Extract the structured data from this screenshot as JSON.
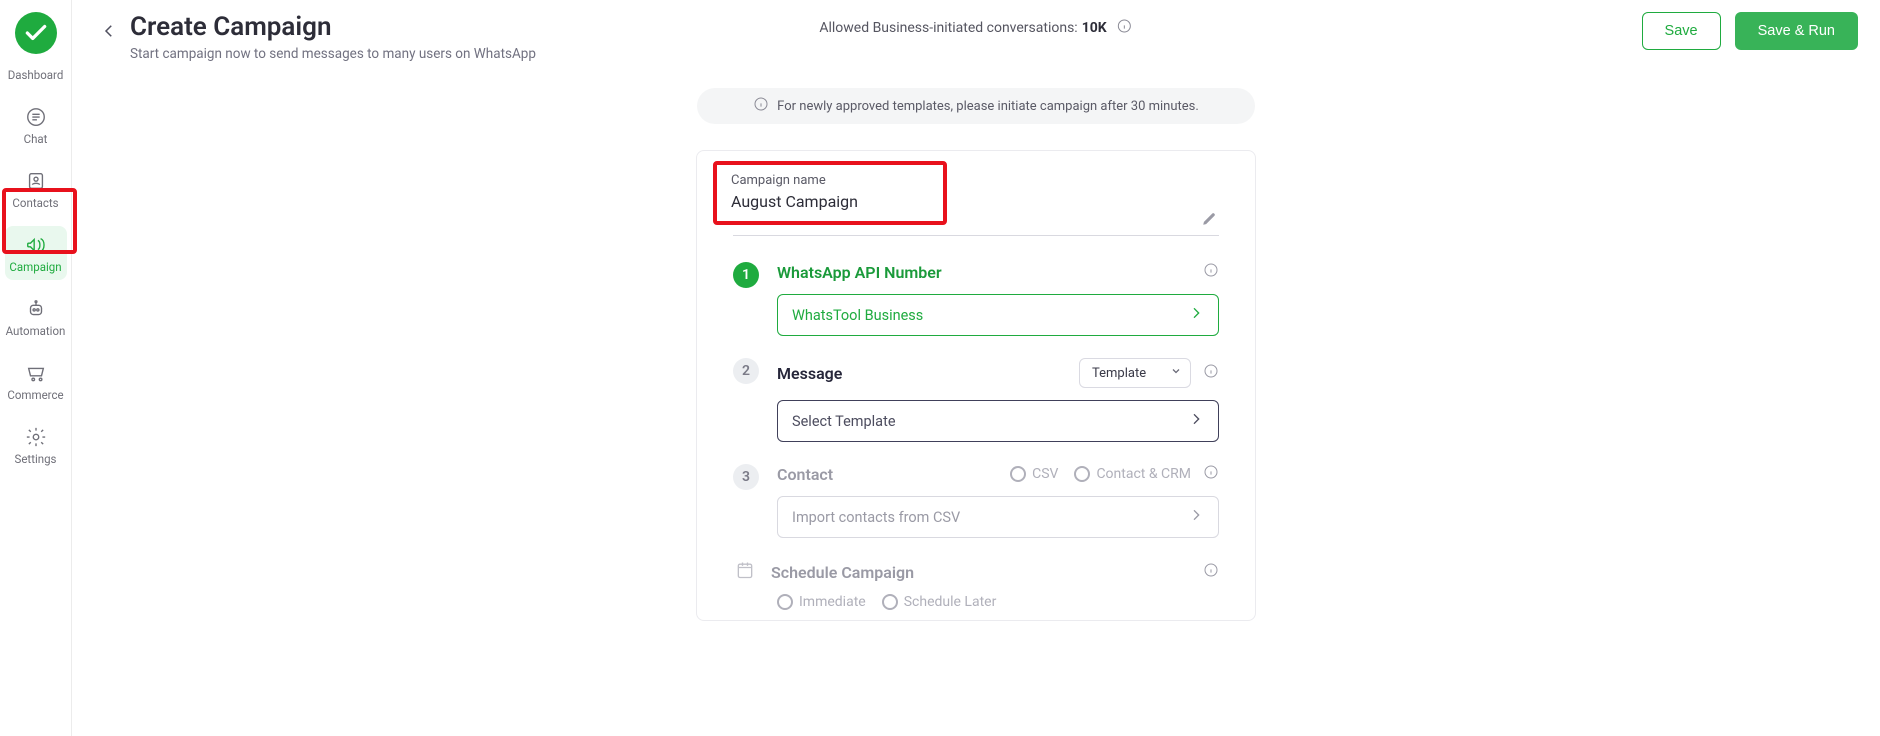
{
  "sidebar": {
    "items": [
      {
        "label": "Dashboard"
      },
      {
        "label": "Chat"
      },
      {
        "label": "Contacts"
      },
      {
        "label": "Campaign"
      },
      {
        "label": "Automation"
      },
      {
        "label": "Commerce"
      },
      {
        "label": "Settings"
      }
    ]
  },
  "header": {
    "title": "Create Campaign",
    "subtitle": "Start campaign now to send messages to many users on WhatsApp",
    "allowance_prefix": "Allowed Business-initiated conversations: ",
    "allowance_value": "10K",
    "save_label": "Save",
    "save_run_label": "Save & Run"
  },
  "notice": "For newly approved templates, please initiate campaign after 30 minutes.",
  "campaign": {
    "name_label": "Campaign name",
    "name_value": "August Campaign",
    "steps": {
      "api": {
        "num": "1",
        "title": "WhatsApp API Number",
        "selected": "WhatsTool Business"
      },
      "message": {
        "num": "2",
        "title": "Message",
        "type_selected": "Template",
        "select_placeholder": "Select Template"
      },
      "contact": {
        "num": "3",
        "title": "Contact",
        "radio_csv": "CSV",
        "radio_crm": "Contact & CRM",
        "import_placeholder": "Import contacts from CSV"
      },
      "schedule": {
        "title": "Schedule Campaign",
        "radio_immediate": "Immediate",
        "radio_later": "Schedule Later"
      }
    }
  }
}
